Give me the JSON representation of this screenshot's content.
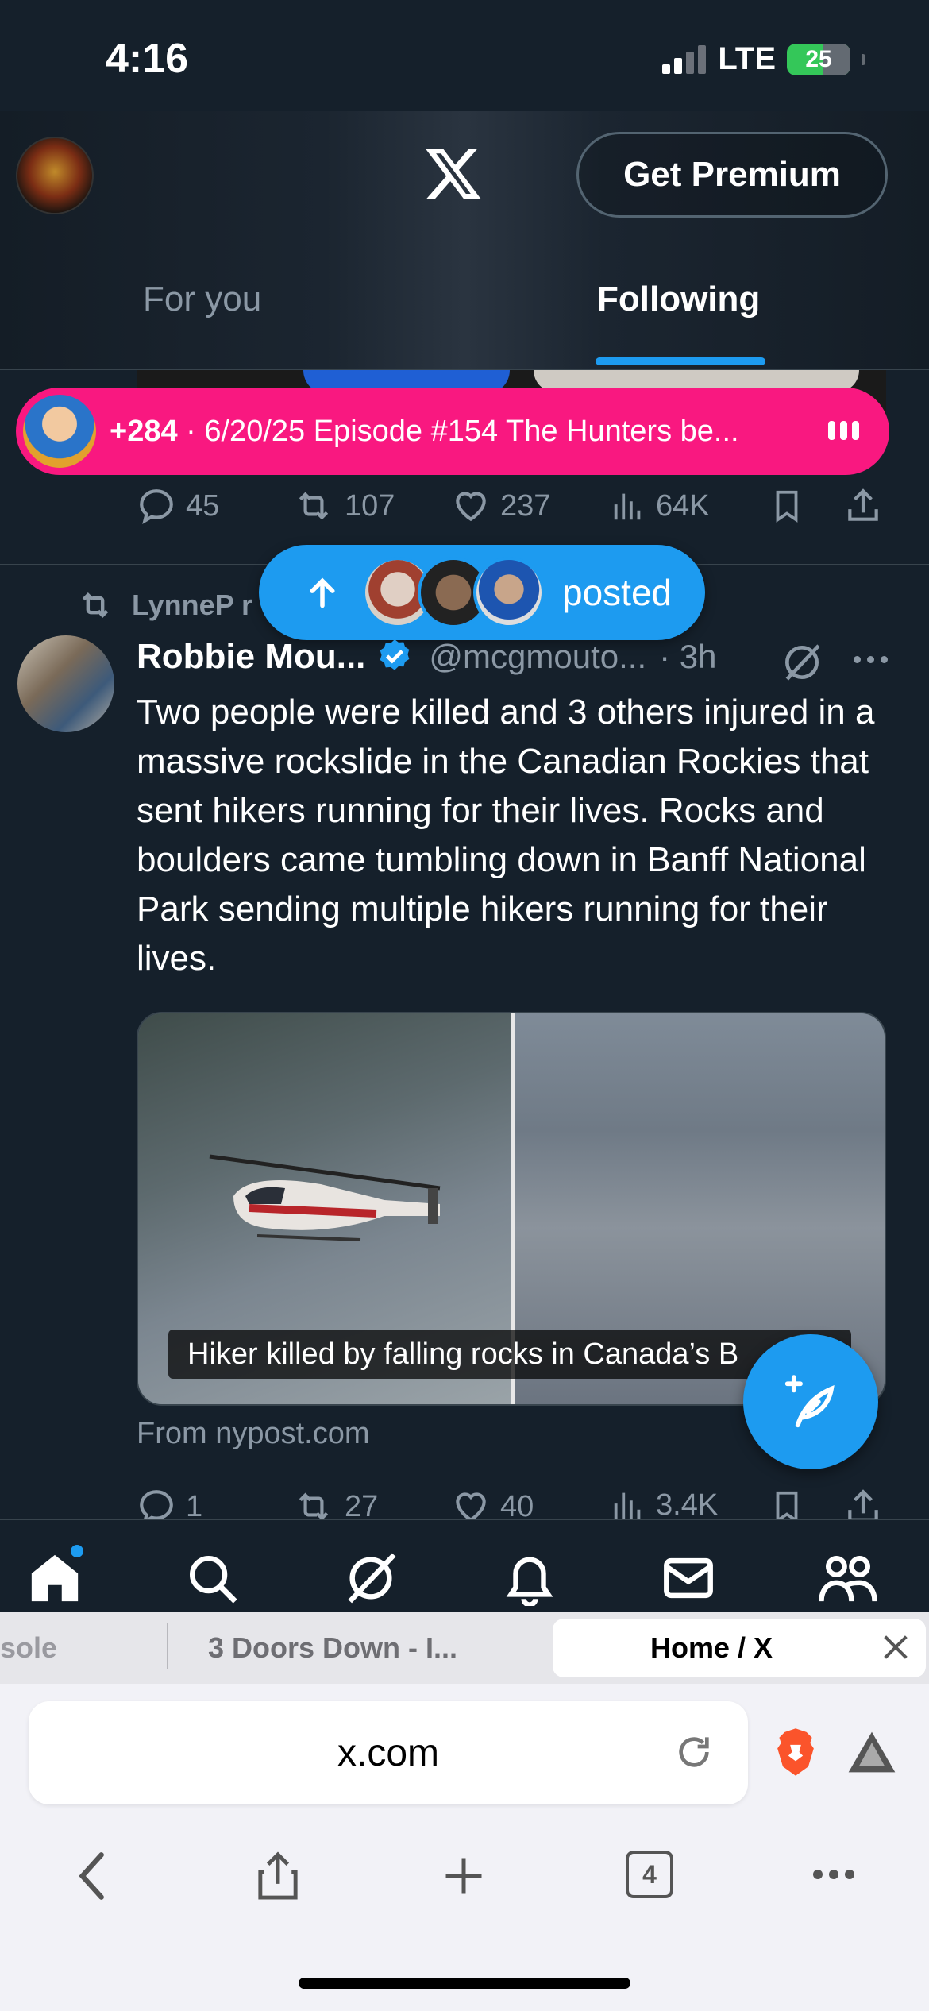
{
  "status": {
    "time": "4:16",
    "network": "LTE",
    "battery": "25"
  },
  "header": {
    "premium_label": "Get Premium"
  },
  "tabs": [
    {
      "label": "For you",
      "active": false
    },
    {
      "label": "Following",
      "active": true
    }
  ],
  "spaces": {
    "count": "+284",
    "title": "· 6/20/25 Episode #154 The Hunters be..."
  },
  "prev_post_actions": {
    "replies": "45",
    "reposts": "107",
    "likes": "237",
    "views": "64K"
  },
  "new_posts_pill": {
    "label": "posted"
  },
  "post": {
    "reposted_by": "LynneP r",
    "author_name": "Robbie Mou...",
    "author_handle": "@mcgmouto...",
    "time": "· 3h",
    "text": "Two people were killed and 3 others injured in a massive rockslide in the Canadian Rockies that sent hikers running for their lives. Rocks and boulders came tumbling down in Banff National Park sending multiple hikers running for their lives.",
    "media_caption": "Hiker killed by falling rocks in Canada’s B",
    "source": "From nypost.com",
    "actions": {
      "replies": "1",
      "reposts": "27",
      "likes": "40",
      "views": "3.4K"
    }
  },
  "bottom_nav": [
    "home-icon",
    "search-icon",
    "grok-icon",
    "notifications-icon",
    "messages-icon",
    "communities-icon"
  ],
  "browser": {
    "tabs": [
      {
        "label": "sole"
      },
      {
        "label": "3 Doors Down - I..."
      },
      {
        "label": "Home / X",
        "active": true
      }
    ],
    "url": "x.com",
    "tab_count": "4"
  },
  "colors": {
    "accent": "#1d9bf0",
    "spaces": "#f91880",
    "background": "#15202b"
  }
}
